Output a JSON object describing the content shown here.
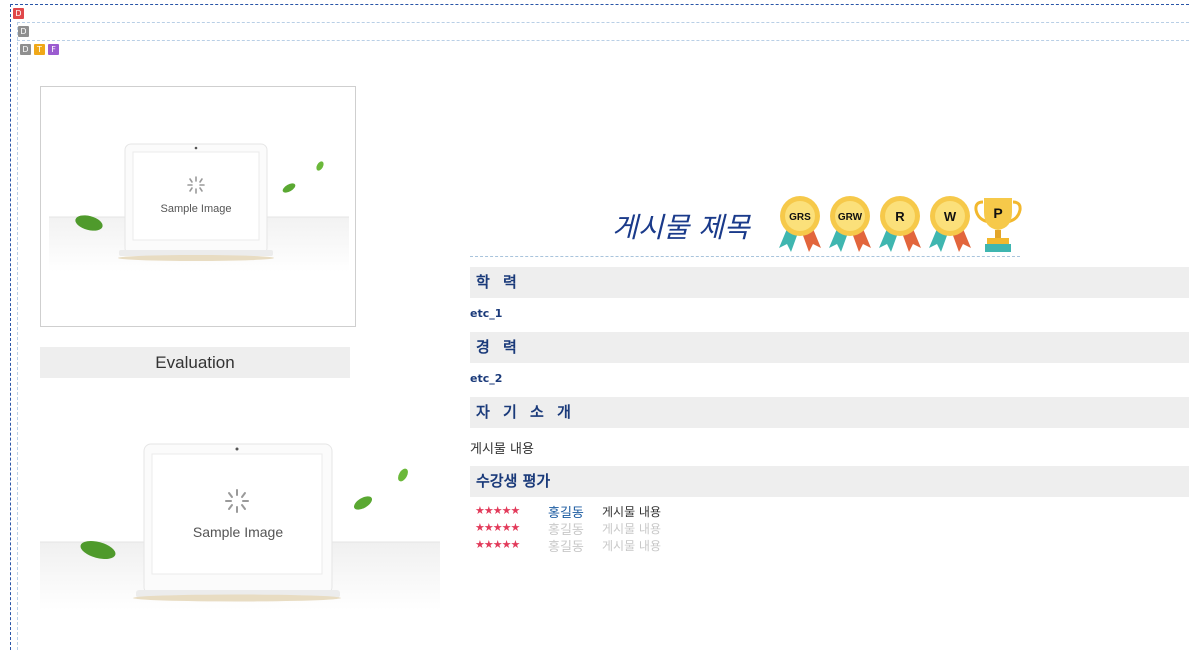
{
  "debug_badges": [
    "D",
    "D",
    "D",
    "T",
    "F"
  ],
  "thumbnail": {
    "label": "Sample Image"
  },
  "evaluation_label": "Evaluation",
  "large_image": {
    "label": "Sample Image"
  },
  "post": {
    "title": "게시물 제목",
    "award_badges": [
      {
        "label": "GRS",
        "icon": "medal-icon"
      },
      {
        "label": "GRW",
        "icon": "medal-icon"
      },
      {
        "label": "R",
        "icon": "medal-icon"
      },
      {
        "label": "W",
        "icon": "medal-icon"
      },
      {
        "label": "P",
        "icon": "trophy-icon"
      }
    ]
  },
  "sections": {
    "education": {
      "heading": "학 력",
      "value": "etc_1"
    },
    "career": {
      "heading": "경 력",
      "value": "etc_2"
    },
    "intro": {
      "heading": "자 기 소 개",
      "value": "게시물 내용"
    },
    "reviews": {
      "heading": "수강생 평가",
      "items": [
        {
          "stars": "★★★★★",
          "name": "홍길동",
          "text": "게시물 내용",
          "state": "active"
        },
        {
          "stars": "★★★★★",
          "name": "홍길동",
          "text": "게시물 내용",
          "state": "dim"
        },
        {
          "stars": "★★★★★",
          "name": "홍길동",
          "text": "게시물 내용",
          "state": "dim"
        }
      ]
    }
  },
  "colors": {
    "heading_text": "#1a3a7a",
    "star": "#e23a5a",
    "section_bg": "#eeeeee",
    "title": "#1a3a8a"
  }
}
